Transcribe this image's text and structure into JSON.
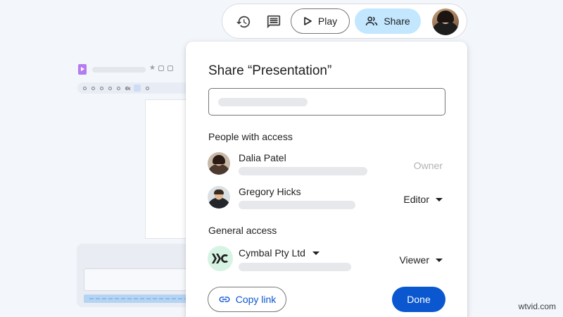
{
  "topbar": {
    "history_icon": "history-icon",
    "comments_icon": "comments-icon",
    "play_label": "Play",
    "share_label": "Share"
  },
  "dialog": {
    "title": "Share “Presentation”",
    "people_heading": "People with access",
    "people": [
      {
        "name": "Dalia Patel",
        "role": "Owner"
      },
      {
        "name": "Gregory Hicks",
        "role": "Editor"
      }
    ],
    "general_heading": "General access",
    "general": {
      "org": "Cymbal Pty Ltd",
      "role": "Viewer"
    },
    "copy_link_label": "Copy link",
    "done_label": "Done"
  },
  "background_editor": {
    "zoom_label": "Fit"
  },
  "watermark": "wtvid.com",
  "colors": {
    "primary": "#0b57d0",
    "share_button": "#c2e7ff",
    "org_logo_bg": "#d7f3e3",
    "background": "#f3f6fb"
  }
}
